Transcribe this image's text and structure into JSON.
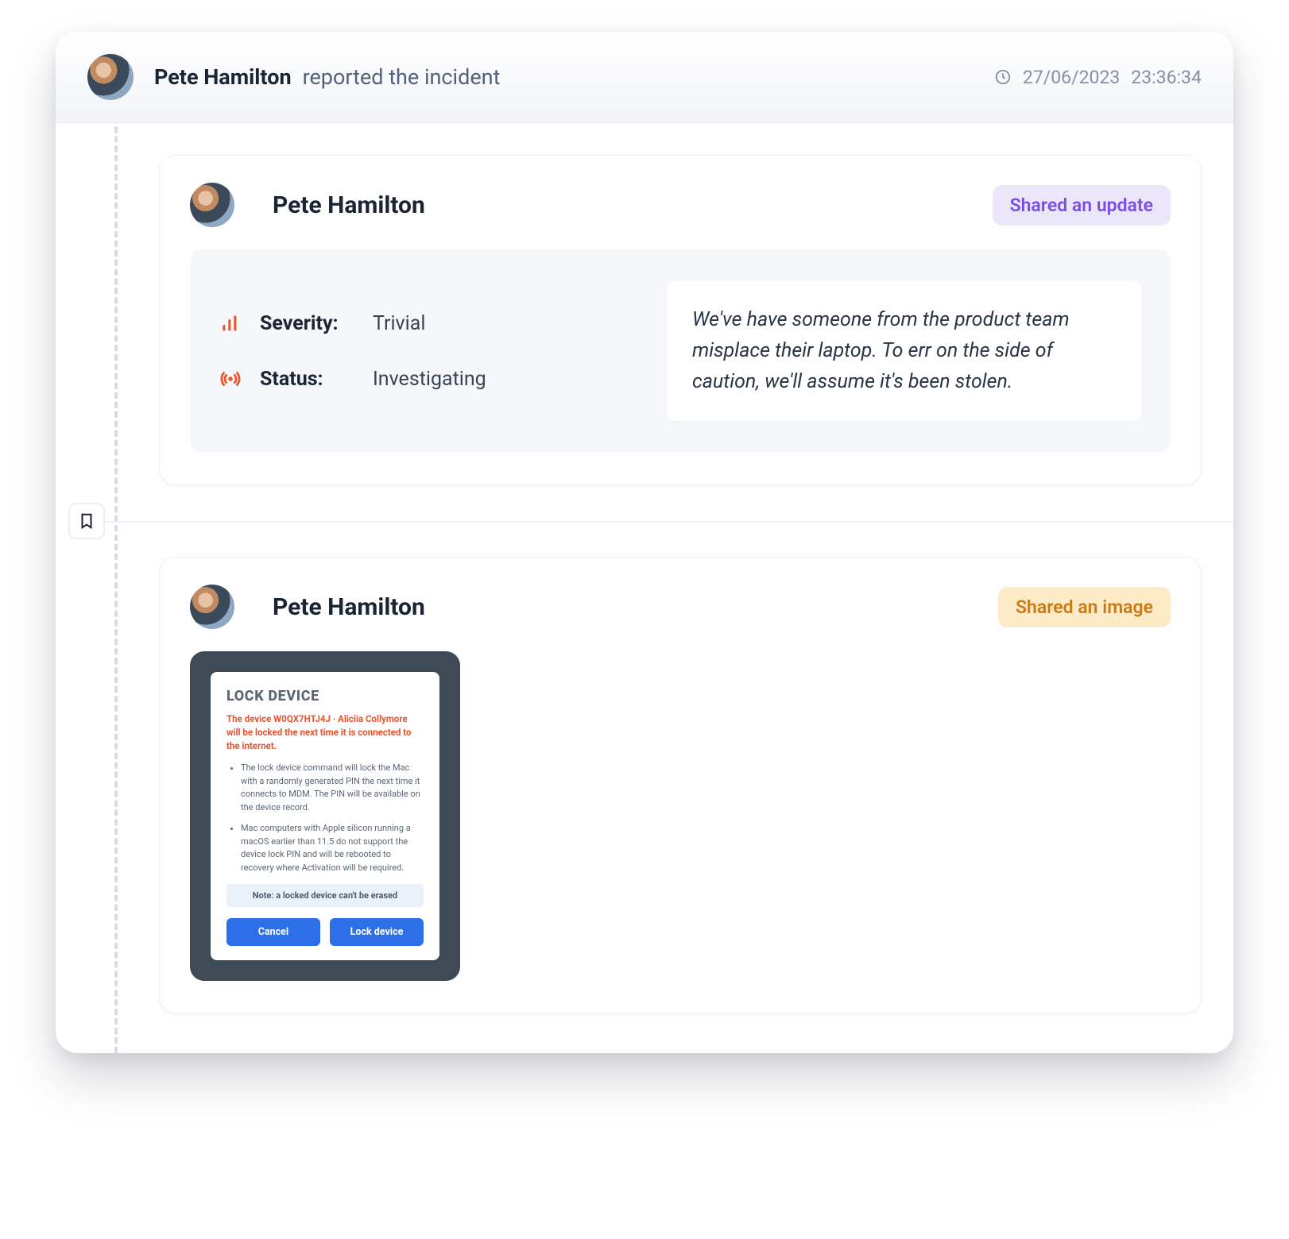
{
  "header": {
    "author": "Pete Hamilton",
    "action": "reported the incident",
    "date": "27/06/2023",
    "time": "23:36:34"
  },
  "events": [
    {
      "author": "Pete Hamilton",
      "badge": "Shared an update",
      "severity_label": "Severity:",
      "severity_value": "Trivial",
      "status_label": "Status:",
      "status_value": "Investigating",
      "quote": "We've have someone from the product team misplace their laptop. To err on the side of caution, we'll assume it's been stolen."
    },
    {
      "author": "Pete Hamilton",
      "badge": "Shared an image",
      "screenshot": {
        "title": "LOCK DEVICE",
        "warning": "The device W0QX7HTJ4J · Aliciia Collymore will be locked the next time it is connected to the internet.",
        "bullet1": "The lock device command will lock the Mac with a randomly generated PIN the next time it connects to MDM. The PIN will be available on the device record.",
        "bullet2": "Mac computers with Apple silicon running a macOS earlier than 11.5 do not support the device lock PIN and will be rebooted to recovery where Activation will be required.",
        "note": "Note: a locked device can't be erased",
        "cancel": "Cancel",
        "confirm": "Lock device"
      }
    }
  ]
}
